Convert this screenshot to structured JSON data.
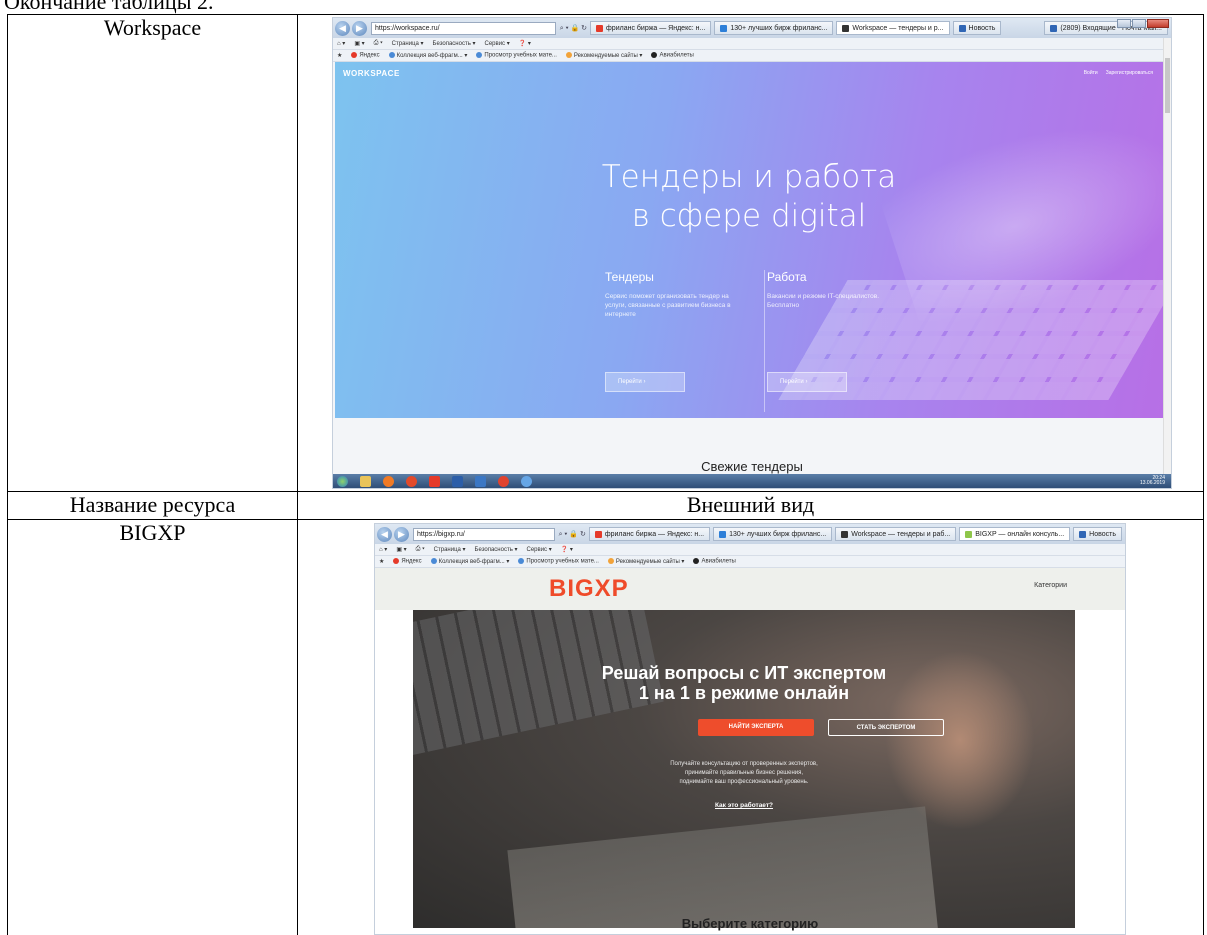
{
  "doc": {
    "heading": "Окончание таблицы 2.",
    "col_name_header": "Название ресурса",
    "col_view_header": "Внешний вид"
  },
  "rows": [
    {
      "name": "Workspace",
      "browser": {
        "url": "https://workspace.ru/",
        "tabs": [
          "фриланс биржа — Яндекс: н...",
          "130+ лучших бирж фриланс...",
          "Workspace — тендеры и р...",
          "Новость"
        ],
        "extra_tab": "(2809) Входящие - Почта Mail...",
        "commands": [
          "Страница ▾",
          "Безопасность ▾",
          "Сервис ▾"
        ],
        "favorites": [
          "Яндекс",
          "Коллекция веб-фрагм... ▾",
          "Просмотр учебных мате...",
          "Рекомендуемые сайты ▾",
          "Авиабилеты"
        ]
      },
      "site": {
        "logo": "WORKSPACE",
        "nav": [
          "Войти",
          "Зарегистрироваться"
        ],
        "title_line1": "Тендеры и работа",
        "title_line2": "в сфере digital",
        "cards": [
          {
            "title": "Тендеры",
            "text": "Сервис поможет организовать тендер на услуги, связанные с развитием бизнеса в интернете",
            "button": "Перейти  ›"
          },
          {
            "title": "Работа",
            "text": "Вакансии и резюме IT-специалистов. Бесплатно",
            "button": "Перейти  ›"
          }
        ],
        "section_title": "Свежие тендеры"
      },
      "taskbar_time": "20:24",
      "taskbar_date": "13.06.2019"
    },
    {
      "name": "BIGXP",
      "browser": {
        "url": "https://bigxp.ru/",
        "tabs": [
          "фриланс биржа — Яндекс: н...",
          "130+ лучших бирж фриланс...",
          "Workspace — тендеры и раб...",
          "BIGXP — онлайн консуль...",
          "Новость"
        ],
        "commands": [
          "Страница ▾",
          "Безопасность ▾",
          "Сервис ▾"
        ],
        "favorites": [
          "Яндекс",
          "Коллекция веб-фрагм... ▾",
          "Просмотр учебных мате...",
          "Рекомендуемые сайты ▾",
          "Авиабилеты"
        ]
      },
      "site": {
        "logo": "BIGXP",
        "nav": "Категории",
        "title_line1": "Решай вопросы с ИТ экспертом",
        "title_line2": "1 на 1 в режиме онлайн",
        "btn_find": "НАЙТИ ЭКСПЕРТА",
        "btn_become": "СТАТЬ ЭКСПЕРТОМ",
        "desc_line1": "Получайте консультацию от проверенных экспертов,",
        "desc_line2": "принимайте правильные бизнес решения,",
        "desc_line3": "поднимайте ваш профессиональный уровень.",
        "how_link": "Как это работает?",
        "section_title": "Выберите категорию"
      }
    }
  ],
  "colors": {
    "ws_gradient_start": "#7dc3ef",
    "ws_gradient_end": "#b76fe6",
    "bigxp_accent": "#ee4d2c"
  }
}
